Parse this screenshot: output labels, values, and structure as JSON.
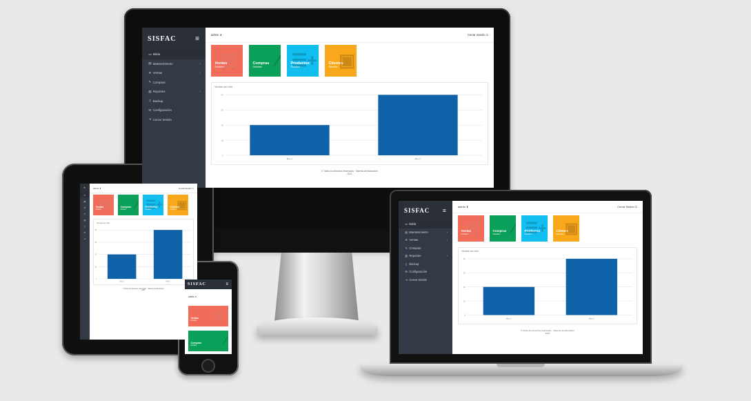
{
  "brand": "SISFAC",
  "user": "admin",
  "logout": "Cerrar Sesión",
  "nav": [
    {
      "label": "Inicio",
      "icon": "monitor-icon",
      "glyph": "▭",
      "chevron": false,
      "active": true
    },
    {
      "label": "Mantenimiento",
      "icon": "table-icon",
      "glyph": "▤",
      "chevron": true,
      "active": false
    },
    {
      "label": "Ventas",
      "icon": "gear-icon",
      "glyph": "✲",
      "chevron": true,
      "active": false
    },
    {
      "label": "Compras",
      "icon": "pencil-icon",
      "glyph": "✎",
      "chevron": false,
      "active": false
    },
    {
      "label": "Reportes",
      "icon": "bar-chart-icon",
      "glyph": "▥",
      "chevron": true,
      "active": false
    },
    {
      "label": "Backup",
      "icon": "trash-icon",
      "glyph": "▯",
      "chevron": false,
      "active": false
    },
    {
      "label": "Configuración",
      "icon": "settings-icon",
      "glyph": "✉",
      "chevron": false,
      "active": false
    },
    {
      "label": "Cerrar Sesión",
      "icon": "sign-out-icon",
      "glyph": "⇥",
      "chevron": false,
      "active": false
    }
  ],
  "cards": [
    {
      "name": "Ventas",
      "sub": "Detalles",
      "color": "#f26c5a",
      "icon": "cart-icon",
      "glyph": "🛒"
    },
    {
      "name": "Compras",
      "sub": "Detalles",
      "color": "#0ba05a",
      "icon": "brush-icon",
      "glyph": "⁄"
    },
    {
      "name": "Productos",
      "sub": "Detalles",
      "color": "#12bdf0",
      "icon": "list-plus-icon",
      "glyph": "☰+"
    },
    {
      "name": "Clientes",
      "sub": "Detalles",
      "color": "#f9a81c",
      "icon": "id-card-icon",
      "glyph": "▣"
    }
  ],
  "chart_title": "Ventas del año",
  "footer_line1": "© Todos los derechos reservados · Sistema de facturación",
  "footer_line2": "2021",
  "chart_data": {
    "type": "bar",
    "categories": [
      "Mes 1",
      "Mes 2"
    ],
    "values": [
      20,
      40
    ],
    "ylim": [
      0,
      40
    ],
    "yticks": [
      0,
      10,
      20,
      30,
      40
    ],
    "color": "#0f62a8",
    "grid": true
  }
}
